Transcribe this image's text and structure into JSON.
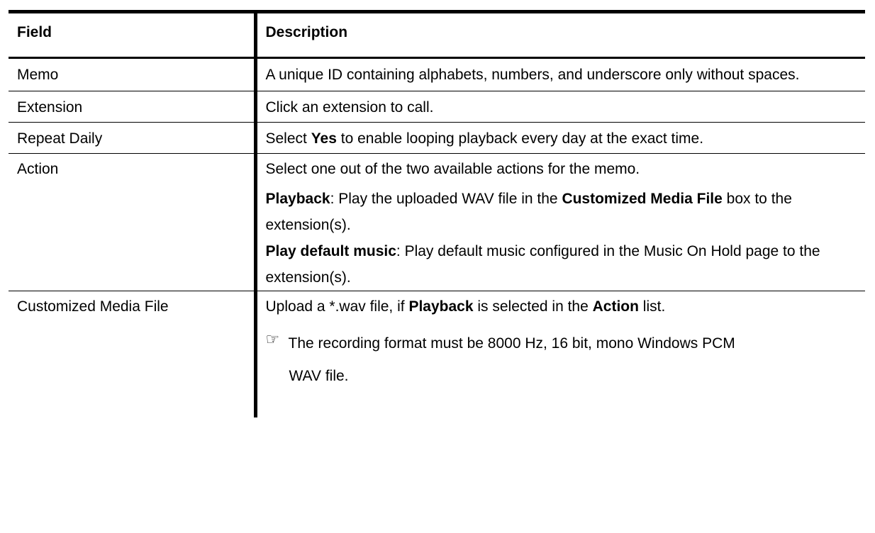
{
  "headers": {
    "field": "Field",
    "description": "Description"
  },
  "rows": {
    "memo": {
      "field": "Memo",
      "desc": "A unique ID containing alphabets, numbers, and underscore only without spaces."
    },
    "extension": {
      "field": "Extension",
      "desc": "Click an extension to call."
    },
    "repeat": {
      "field": "Repeat Daily",
      "pre": "Select ",
      "bold": "Yes",
      "post": " to enable looping playback every day at the exact time."
    },
    "action": {
      "field": "Action",
      "line1": "Select one out of the two available actions for the memo.",
      "playback_bold": "Playback",
      "playback_text_a": ": Play the uploaded WAV file in the ",
      "playback_bold2": "Customized Media File",
      "playback_text_b": " box to the extension(s).",
      "default_bold": "Play default music",
      "default_text": ": Play default music configured in the Music On Hold page to the extension(s)."
    },
    "media": {
      "field": "Customized Media File",
      "pre": "Upload a *.wav file, if ",
      "bold1": "Playback",
      "mid": " is selected in the ",
      "bold2": "Action",
      "post": " list.",
      "note_icon": "hand-pointing-right-icon",
      "note_line1": "The recording format must be 8000 Hz, 16 bit, mono Windows PCM",
      "note_line2": "WAV file."
    }
  }
}
